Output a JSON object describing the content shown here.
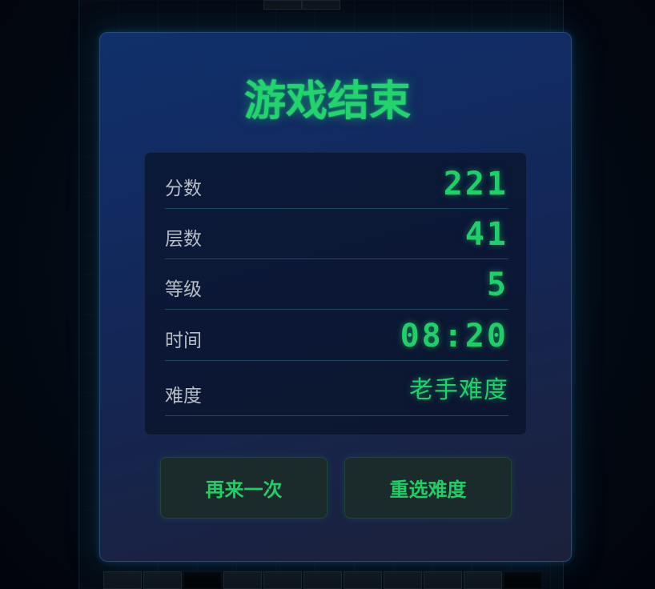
{
  "title": "游戏结束",
  "stats": [
    {
      "label": "分数",
      "value": "221"
    },
    {
      "label": "层数",
      "value": "41"
    },
    {
      "label": "等级",
      "value": "5"
    },
    {
      "label": "时间",
      "value": "08:20"
    },
    {
      "label": "难度",
      "value": "老手难度"
    }
  ],
  "buttons": {
    "restart": "再来一次",
    "reselect": "重选难度"
  },
  "colors": {
    "accent": "#22d36e",
    "modal_bg": "#13275a",
    "panel_bg": "#0a1428",
    "label": "#b7bdc6"
  }
}
